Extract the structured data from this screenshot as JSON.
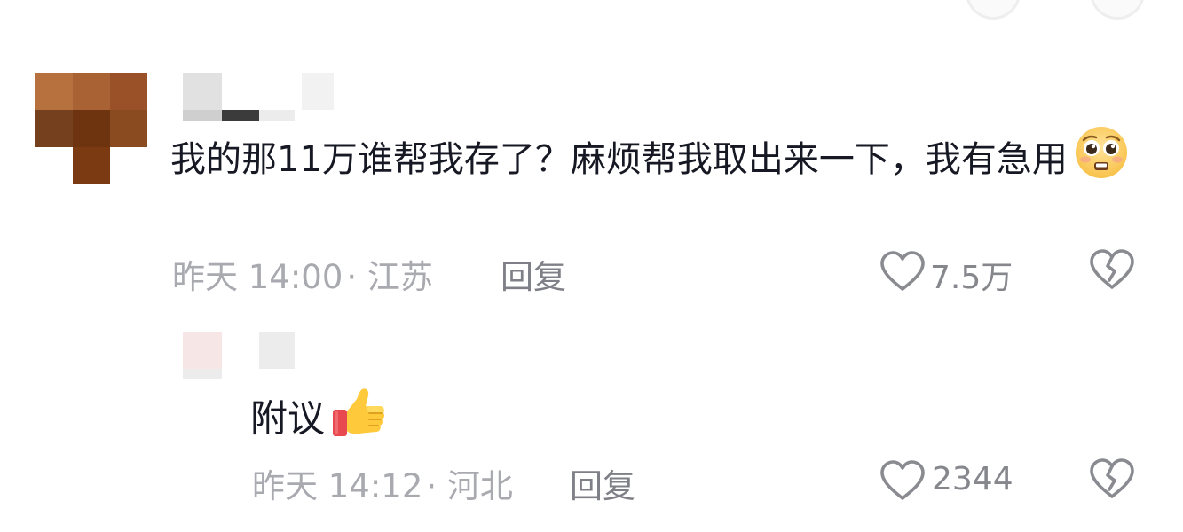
{
  "comments": [
    {
      "text": "我的那11万谁帮我存了？麻烦帮我取出来一下，我有急用",
      "emoji": "pleading-face-icon",
      "time": "昨天 14:00",
      "location": "· 江苏",
      "reply_label": "回复",
      "likes": "7.5万",
      "replies": [
        {
          "text": "附议",
          "emoji": "thumbs-up-icon",
          "time": "昨天 14:12",
          "location": "· 河北",
          "reply_label": "回复",
          "likes": "2344"
        }
      ]
    }
  ],
  "colors": {
    "text": "#161823",
    "meta": "#a9aab0",
    "action": "#7f8087"
  }
}
